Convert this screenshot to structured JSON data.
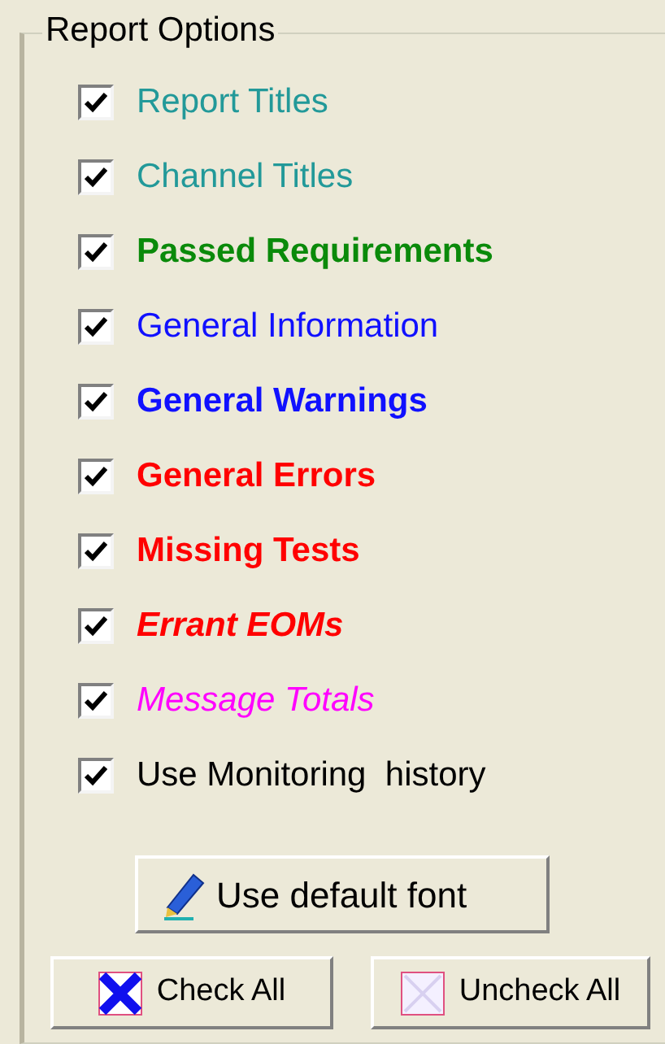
{
  "group": {
    "title": "Report Options"
  },
  "options": [
    {
      "label": "Report Titles",
      "checked": true,
      "color": "#229999",
      "kind": "regular"
    },
    {
      "label": "Channel Titles",
      "checked": true,
      "color": "#229999",
      "kind": "regular"
    },
    {
      "label": "Passed Requirements",
      "checked": true,
      "color": "#0a8a0a",
      "kind": "bold"
    },
    {
      "label": "General Information",
      "checked": true,
      "color": "#1010ff",
      "kind": "regular"
    },
    {
      "label": "General Warnings",
      "checked": true,
      "color": "#1010ff",
      "kind": "bold"
    },
    {
      "label": "General Errors",
      "checked": true,
      "color": "#ff0000",
      "kind": "bold"
    },
    {
      "label": "Missing Tests",
      "checked": true,
      "color": "#ff0000",
      "kind": "bold"
    },
    {
      "label": "Errant EOMs",
      "checked": true,
      "color": "#ff0000",
      "kind": "emphasis"
    },
    {
      "label": "Message Totals",
      "checked": true,
      "color": "#ff00ff",
      "kind": "italic"
    },
    {
      "label": "Use Monitoring  history",
      "checked": true,
      "color": "#000000",
      "kind": "regular"
    }
  ],
  "buttons": {
    "default_font": "Use default font",
    "check_all": "Check All",
    "uncheck_all": "Uncheck All"
  }
}
